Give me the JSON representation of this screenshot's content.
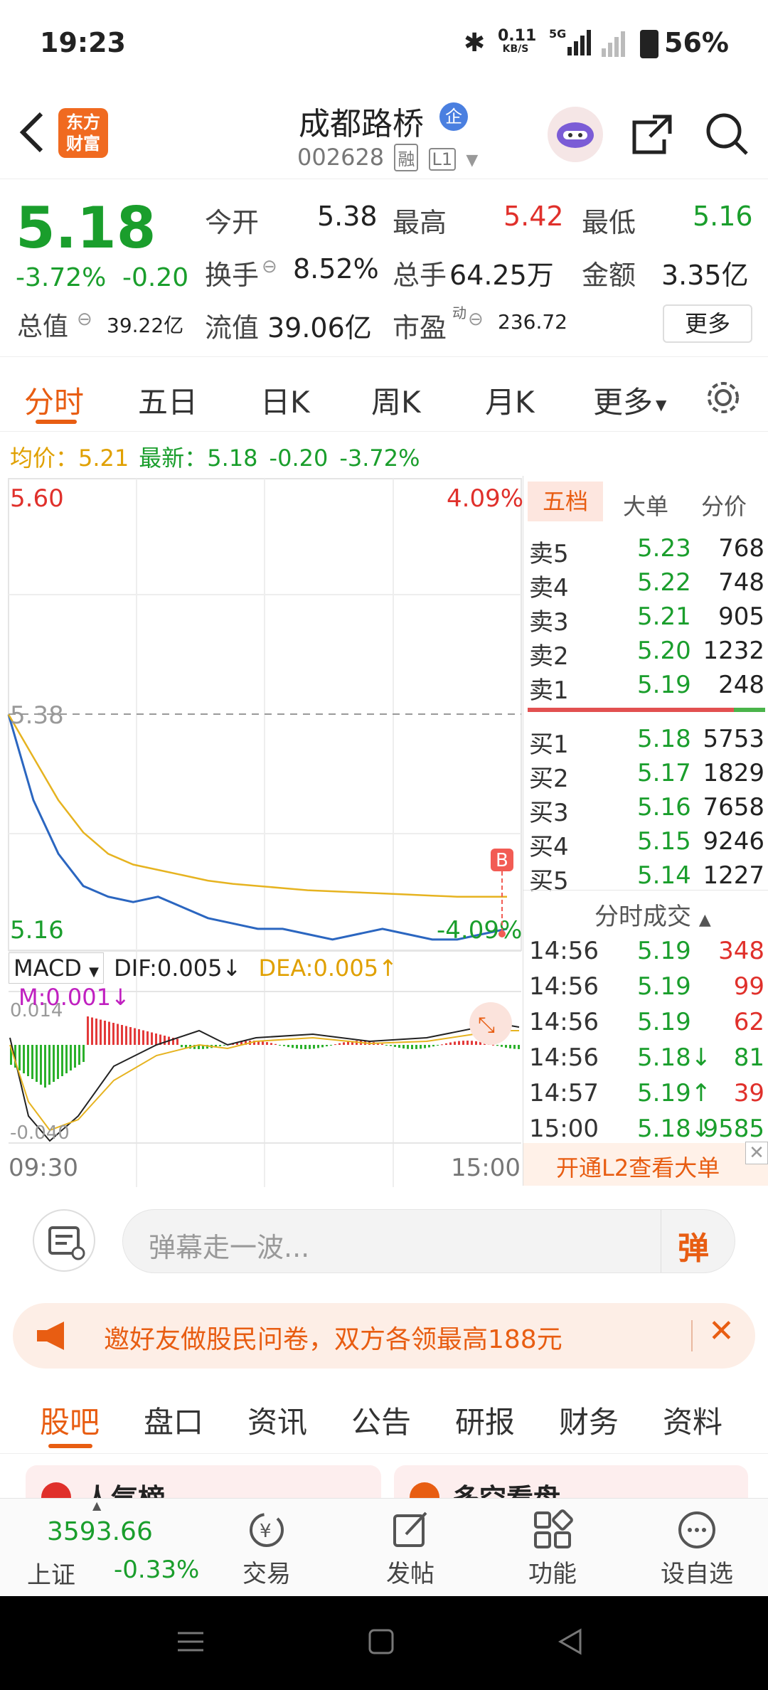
{
  "status": {
    "time": "19:23",
    "net_speed_value": "0.11",
    "net_speed_unit": "KB/S",
    "network": "5G",
    "battery": "56%"
  },
  "header": {
    "logo_line1": "东方",
    "logo_line2": "财富",
    "stock_name": "成都路桥",
    "badge": "企",
    "stock_code": "002628",
    "tag_rong": "融",
    "tag_level": "L1"
  },
  "quote": {
    "price": "5.18",
    "change_pct": "-3.72%",
    "change": "-0.20",
    "open_label": "今开",
    "open": "5.38",
    "high_label": "最高",
    "high": "5.42",
    "low_label": "最低",
    "low": "5.16",
    "turnover_label": "换手",
    "turnover": "8.52%",
    "volume_label": "总手",
    "volume": "64.25万",
    "amount_label": "金额",
    "amount": "3.35亿",
    "mcap_label": "总值",
    "mcap": "39.22亿",
    "float_label": "流值",
    "float": "39.06亿",
    "pe_label": "市盈",
    "pe_sup": "动",
    "pe": "236.72",
    "more_button": "更多"
  },
  "tabs": {
    "items": [
      "分时",
      "五日",
      "日K",
      "周K",
      "月K",
      "更多"
    ],
    "active": 0
  },
  "info": {
    "avg_label": "均价：",
    "avg": "5.21",
    "latest_label": "最新：",
    "latest": "5.18",
    "chg": "-0.20",
    "pct": "-3.72%"
  },
  "chart": {
    "ymax_label": "5.60",
    "ymax_pct": "4.09%",
    "prev_close_label": "5.38",
    "ymin_label": "5.16",
    "ymin_pct": "-4.09%",
    "b_marker": "B",
    "macd_selector": "MACD",
    "dif": "DIF:0.005",
    "dea": "DEA:0.005",
    "m": "M:0.001",
    "macd_top": "0.014",
    "macd_bottom": "-0.040",
    "time_start": "09:30",
    "time_end": "15:00"
  },
  "chart_data": {
    "type": "line",
    "title": "",
    "x": [
      "09:30",
      "15:00"
    ],
    "ylim": [
      5.16,
      5.6
    ],
    "reference_line": 5.38,
    "series": [
      {
        "values": [
          5.38,
          5.3,
          5.25,
          5.22,
          5.21,
          5.205,
          5.21,
          5.2,
          5.19,
          5.185,
          5.18,
          5.18,
          5.175,
          5.17,
          5.175,
          5.18,
          5.175,
          5.17,
          5.17,
          5.175,
          5.18
        ]
      },
      {
        "values": [
          5.38,
          5.34,
          5.3,
          5.27,
          5.25,
          5.24,
          5.235,
          5.23,
          5.225,
          5.222,
          5.22,
          5.218,
          5.216,
          5.215,
          5.214,
          5.213,
          5.212,
          5.211,
          5.21,
          5.21,
          5.21
        ]
      }
    ]
  },
  "panel": {
    "tabs": [
      "五档",
      "大单",
      "分价"
    ],
    "asks": [
      {
        "label": "卖5",
        "price": "5.23",
        "vol": "768"
      },
      {
        "label": "卖4",
        "price": "5.22",
        "vol": "748"
      },
      {
        "label": "卖3",
        "price": "5.21",
        "vol": "905"
      },
      {
        "label": "卖2",
        "price": "5.20",
        "vol": "1232"
      },
      {
        "label": "卖1",
        "price": "5.19",
        "vol": "248"
      }
    ],
    "bids": [
      {
        "label": "买1",
        "price": "5.18",
        "vol": "5753"
      },
      {
        "label": "买2",
        "price": "5.17",
        "vol": "1829"
      },
      {
        "label": "买3",
        "price": "5.16",
        "vol": "7658"
      },
      {
        "label": "买4",
        "price": "5.15",
        "vol": "9246"
      },
      {
        "label": "买5",
        "price": "5.14",
        "vol": "1227"
      }
    ],
    "ticks_title": "分时成交",
    "ticks": [
      {
        "time": "14:56",
        "price": "5.19",
        "vol": "348"
      },
      {
        "time": "14:56",
        "price": "5.19",
        "vol": "99"
      },
      {
        "time": "14:56",
        "price": "5.19",
        "vol": "62"
      },
      {
        "time": "14:56",
        "price": "5.18↓",
        "vol": "81"
      },
      {
        "time": "14:57",
        "price": "5.19↑",
        "vol": "39"
      },
      {
        "time": "15:00",
        "price": "5.18↓",
        "vol": "9585"
      }
    ],
    "l2_banner": "开通L2查看大单"
  },
  "comment": {
    "placeholder": "弹幕走一波...",
    "danmu_label": "弹"
  },
  "promo": {
    "text": "邀好友做股民问卷，双方各领最高188元"
  },
  "bottom_tabs": [
    "股吧",
    "盘口",
    "资讯",
    "公告",
    "研报",
    "财务",
    "资料"
  ],
  "cards": [
    "人气榜",
    "多空看盘"
  ],
  "bottom_nav": {
    "index_value": "3593.66",
    "index_name": "上证",
    "index_change": "-0.33%",
    "items": [
      "交易",
      "发帖",
      "功能",
      "设自选"
    ]
  }
}
